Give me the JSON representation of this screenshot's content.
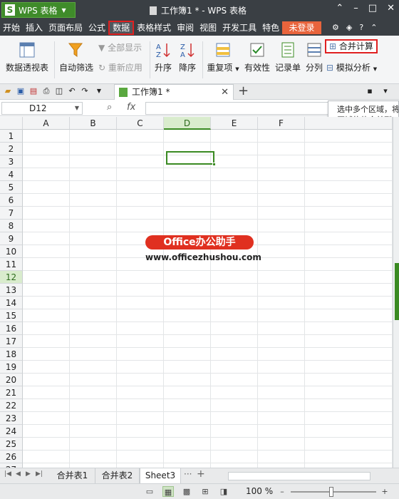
{
  "app": {
    "name": "WPS 表格",
    "logo": "S",
    "doc_title": "工作簿1 * - WPS 表格"
  },
  "menu": [
    "开始",
    "插入",
    "页面布局",
    "公式",
    "数据",
    "表格样式",
    "审阅",
    "视图",
    "开发工具",
    "特色"
  ],
  "menu_selected": "数据",
  "login": "未登录",
  "ribbon": {
    "pivot": "数据透视表",
    "autofilter": "自动筛选",
    "show_all": "全部显示",
    "reapply": "重新应用",
    "asc": "升序",
    "desc": "降序",
    "dup": "重复项",
    "validity": "有效性",
    "record": "记录单",
    "split": "分列",
    "merge_calc": "合并计算",
    "whatif": "模拟分析"
  },
  "doc_tab": "工作簿1 *",
  "formula": {
    "name_box": "D12",
    "fx": "fx",
    "value": ""
  },
  "tooltip": "选中多个区域，将\n区域的值合并到一\n区域中。",
  "columns": [
    "A",
    "B",
    "C",
    "D",
    "E",
    "F"
  ],
  "selected_col": "D",
  "rows": [
    "1",
    "2",
    "3",
    "4",
    "5",
    "6",
    "7",
    "8",
    "9",
    "10",
    "11",
    "12",
    "13",
    "14",
    "15",
    "16",
    "17",
    "18",
    "19",
    "20",
    "21",
    "22",
    "23",
    "24",
    "25",
    "26",
    "27"
  ],
  "selected_row": "12",
  "watermark": {
    "badge": "Office办公助手",
    "url": "www.officezhushou.com"
  },
  "sheets": [
    "合并表1",
    "合并表2",
    "Sheet3"
  ],
  "active_sheet": "Sheet3",
  "zoom": "100 %",
  "colors": {
    "accent": "#3a8a22",
    "titlebar": "#3a3f44",
    "highlight": "#e02020"
  }
}
